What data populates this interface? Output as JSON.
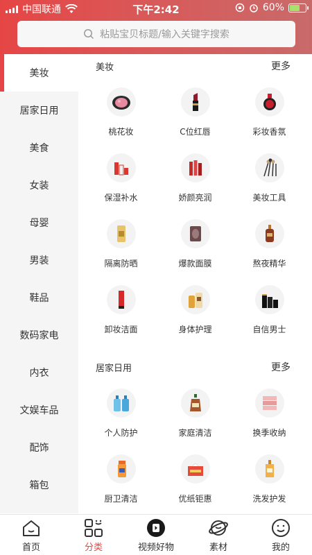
{
  "status_bar": {
    "carrier": "中国联通",
    "time": "下午2:42",
    "battery": "60%",
    "battery_level": 0.6
  },
  "search": {
    "placeholder": "粘贴宝贝标题/输入关键字搜索"
  },
  "sidebar": {
    "items": [
      {
        "label": "美妆"
      },
      {
        "label": "居家日用"
      },
      {
        "label": "美食"
      },
      {
        "label": "女装"
      },
      {
        "label": "母婴"
      },
      {
        "label": "男装"
      },
      {
        "label": "鞋品"
      },
      {
        "label": "数码家电"
      },
      {
        "label": "内衣"
      },
      {
        "label": "文娱车品"
      },
      {
        "label": "配饰"
      },
      {
        "label": "箱包"
      }
    ],
    "active_index": 0
  },
  "sections": [
    {
      "title": "美妆",
      "more": "更多",
      "items": [
        {
          "label": "桃花妆",
          "icon": "blush-compact-icon"
        },
        {
          "label": "C位红唇",
          "icon": "lipstick-icon"
        },
        {
          "label": "彩妆香氛",
          "icon": "perfume-icon"
        },
        {
          "label": "保湿补水",
          "icon": "skincare-set-icon"
        },
        {
          "label": "娇颜亮润",
          "icon": "serum-bottles-icon"
        },
        {
          "label": "美妆工具",
          "icon": "makeup-brushes-icon"
        },
        {
          "label": "隔离防晒",
          "icon": "sunscreen-icon"
        },
        {
          "label": "爆款面膜",
          "icon": "face-mask-icon"
        },
        {
          "label": "熬夜精华",
          "icon": "essence-bottle-icon"
        },
        {
          "label": "卸妆洁面",
          "icon": "cleanser-tube-icon"
        },
        {
          "label": "身体护理",
          "icon": "body-care-icon"
        },
        {
          "label": "自信男士",
          "icon": "mens-care-icon"
        }
      ]
    },
    {
      "title": "居家日用",
      "more": "更多",
      "items": [
        {
          "label": "个人防护",
          "icon": "hand-sanitizer-icon"
        },
        {
          "label": "家庭清洁",
          "icon": "disinfectant-icon"
        },
        {
          "label": "换季收纳",
          "icon": "storage-drawers-icon"
        },
        {
          "label": "厨卫清洁",
          "icon": "spray-cleaner-icon"
        },
        {
          "label": "优纸钜惠",
          "icon": "tissue-box-icon"
        },
        {
          "label": "洗发护发",
          "icon": "shampoo-icon"
        }
      ]
    }
  ],
  "tabbar": {
    "items": [
      {
        "label": "首页",
        "icon": "home-icon"
      },
      {
        "label": "分类",
        "icon": "category-icon"
      },
      {
        "label": "视频好物",
        "icon": "video-icon"
      },
      {
        "label": "素材",
        "icon": "planet-icon"
      },
      {
        "label": "我的",
        "icon": "smile-profile-icon"
      }
    ],
    "active_index": 1
  },
  "colors": {
    "accent": "#e64545",
    "sidebar_bg": "#f5f5f5"
  }
}
